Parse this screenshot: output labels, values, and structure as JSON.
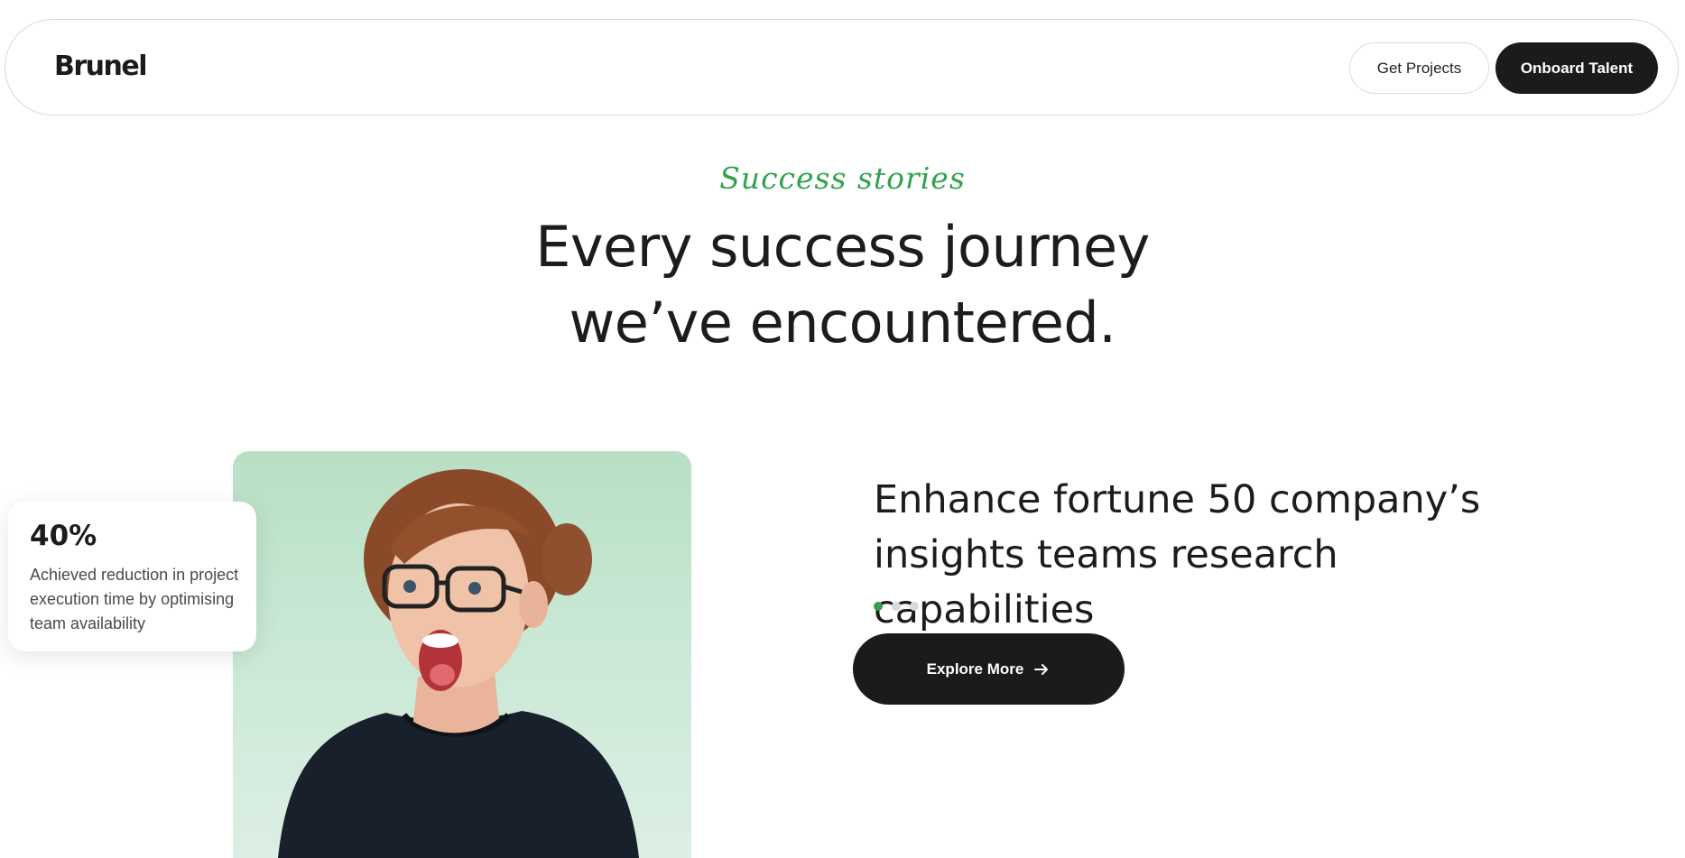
{
  "header": {
    "logo": "Brunel",
    "get_projects_label": "Get Projects",
    "onboard_talent_label": "Onboard Talent"
  },
  "hero": {
    "eyebrow": "Success stories",
    "title_line1": "Every success journey",
    "title_line2": "we’ve encountered."
  },
  "stat_card": {
    "value": "40%",
    "description": "Achieved reduction in project execution time by optimising team availability"
  },
  "story": {
    "title_line1": "Enhance fortune 50 company’s",
    "title_line2": "insights teams research capabilities",
    "slide_count": 3,
    "active_slide": 1,
    "explore_label": "Explore More",
    "explore_icon": "arrow-right-icon"
  },
  "colors": {
    "accent_green": "#2ea44f",
    "dark_button": "#1b1b1b",
    "photo_background": "#c9e8d4"
  }
}
